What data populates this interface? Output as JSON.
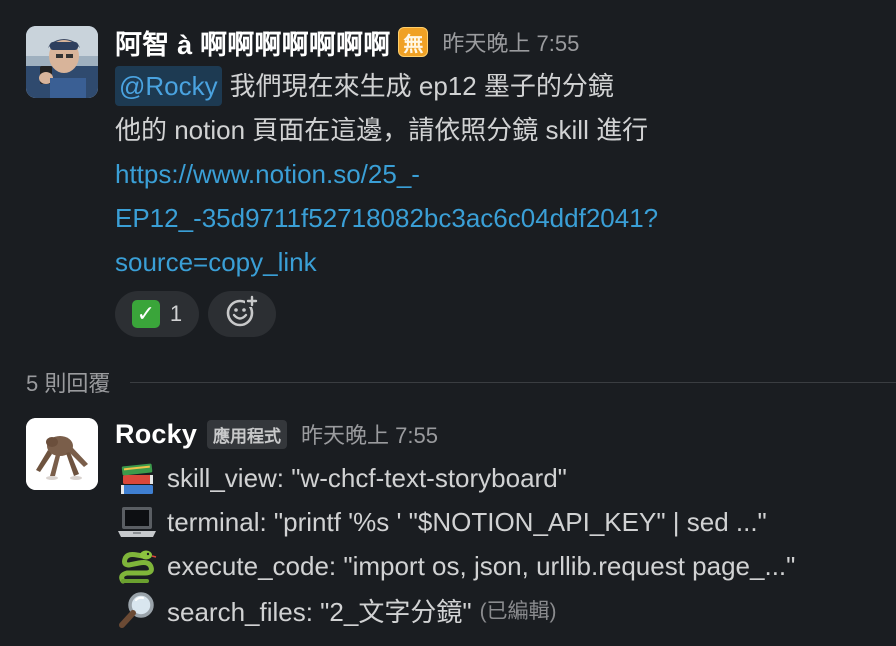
{
  "message1": {
    "sender": "阿智 à 啊啊啊啊啊啊啊",
    "status_emoji": "無",
    "timestamp": "昨天晚上 7:55",
    "mention": "@Rocky",
    "line1_text": "我們現在來生成 ep12 墨子的分鏡",
    "line2_text": "他的 notion 頁面在這邊，請依照分鏡 skill 進行",
    "link_line1": "https://www.notion.so/25_-",
    "link_line2": "EP12_-35d9711f52718082bc3ac6c04ddf2041?",
    "link_line3": "source=copy_link",
    "reactions": [
      {
        "icon": "white-check-mark-icon",
        "glyph": "✓",
        "count": "1"
      }
    ],
    "add_reaction_icon": "add-reaction-icon"
  },
  "replies": {
    "label": "5 則回覆"
  },
  "message2": {
    "sender": "Rocky",
    "badge": "應用程式",
    "timestamp": "昨天晚上 7:55",
    "tools": [
      {
        "icon": "books-icon",
        "text": "skill_view: \"w-chcf-text-storyboard\""
      },
      {
        "icon": "laptop-icon",
        "text": "terminal: \"printf '%s ' \"$NOTION_API_KEY\" | sed ...\""
      },
      {
        "icon": "snake-icon",
        "text": "execute_code: \"import os, json, urllib.request page_...\""
      },
      {
        "icon": "magnifying-glass-icon",
        "text": "search_files: \"2_文字分鏡\""
      }
    ],
    "edited_label": "(已編輯)"
  },
  "colors": {
    "background": "#1a1d21",
    "link": "#3a9fd6",
    "mention_bg": "#1d3a52",
    "mention_text": "#4aa3e0",
    "reaction_bg": "#2c2f33",
    "muted": "#9a9b9e"
  }
}
